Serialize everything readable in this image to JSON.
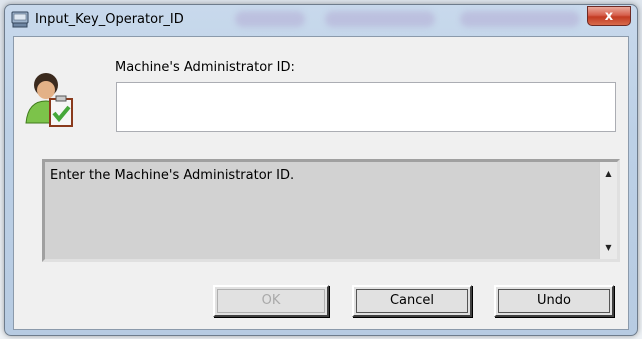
{
  "window": {
    "title": "Input_Key_Operator_ID",
    "close_label": "x"
  },
  "form": {
    "field_label": "Machine's Administrator ID:",
    "field_value": "",
    "message": "Enter the Machine's Administrator ID."
  },
  "buttons": {
    "ok_label": "OK",
    "cancel_label": "Cancel",
    "undo_label": "Undo"
  },
  "icons": {
    "app": "keyboard-icon",
    "user": "operator-clipboard-icon",
    "scroll_up": "scroll-up-arrow-icon",
    "scroll_down": "scroll-down-arrow-icon"
  },
  "colors": {
    "title_bar": "#c8d9ec",
    "close_button": "#c23b22",
    "client_bg": "#f0f0f0",
    "message_bg": "#d2d2d2"
  }
}
